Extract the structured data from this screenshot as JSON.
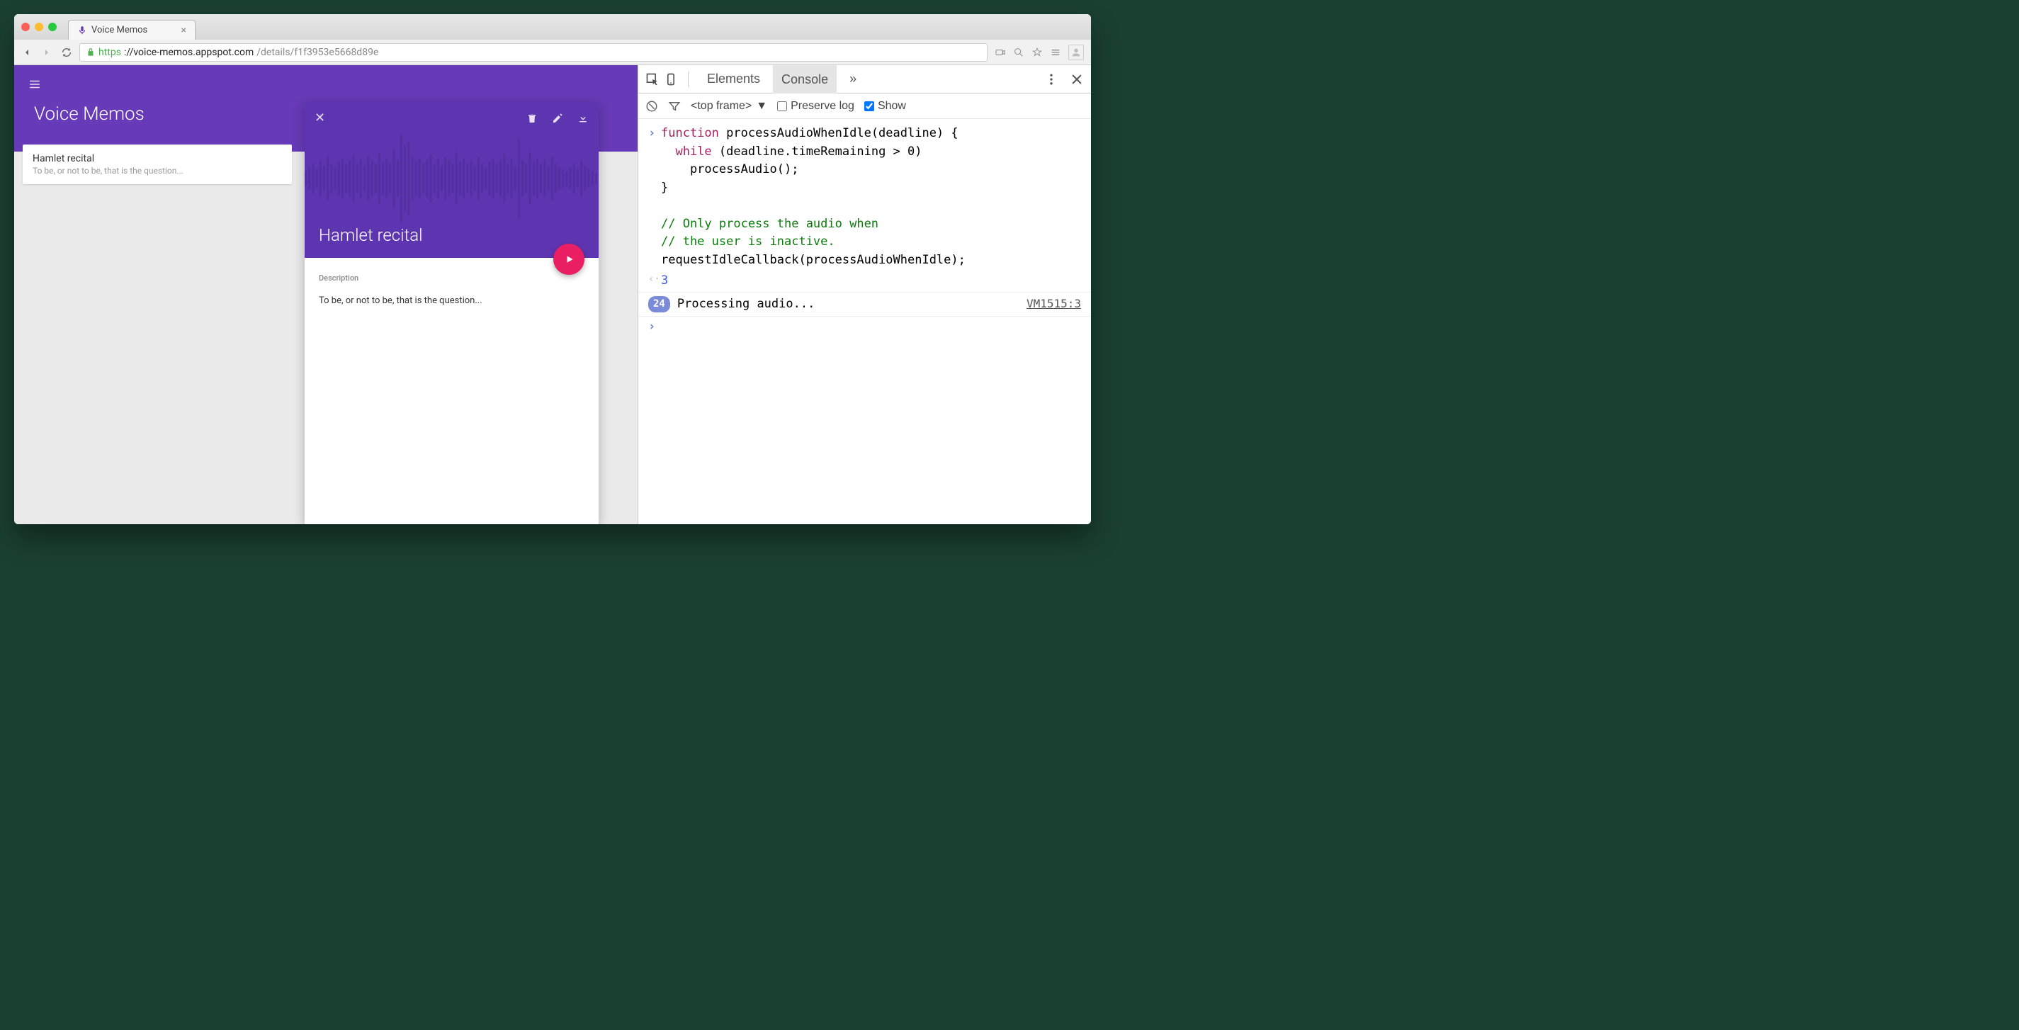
{
  "tab": {
    "title": "Voice Memos"
  },
  "url": {
    "scheme": "https",
    "host": "://voice-memos.appspot.com",
    "path": "/details/f1f3953e5668d89e"
  },
  "app": {
    "title": "Voice Memos",
    "list": [
      {
        "title": "Hamlet recital",
        "subtitle": "To be, or not to be, that is the question..."
      }
    ],
    "detail": {
      "title": "Hamlet recital",
      "description_label": "Description",
      "description": "To be, or not to be, that is the question..."
    }
  },
  "devtools": {
    "tabs": {
      "elements": "Elements",
      "console": "Console",
      "more": "»"
    },
    "filterbar": {
      "frame": "<top frame>",
      "preserve_label": "Preserve log",
      "show_label": "Show"
    },
    "code": "function processAudioWhenIdle(deadline) {\n  while (deadline.timeRemaining > 0)\n    processAudio();\n}\n\n// Only process the audio when\n// the user is inactive.\nrequestIdleCallback(processAudioWhenIdle);",
    "return_value": "3",
    "log": {
      "count": "24",
      "message": "Processing audio...",
      "source": "VM1515:3"
    }
  }
}
